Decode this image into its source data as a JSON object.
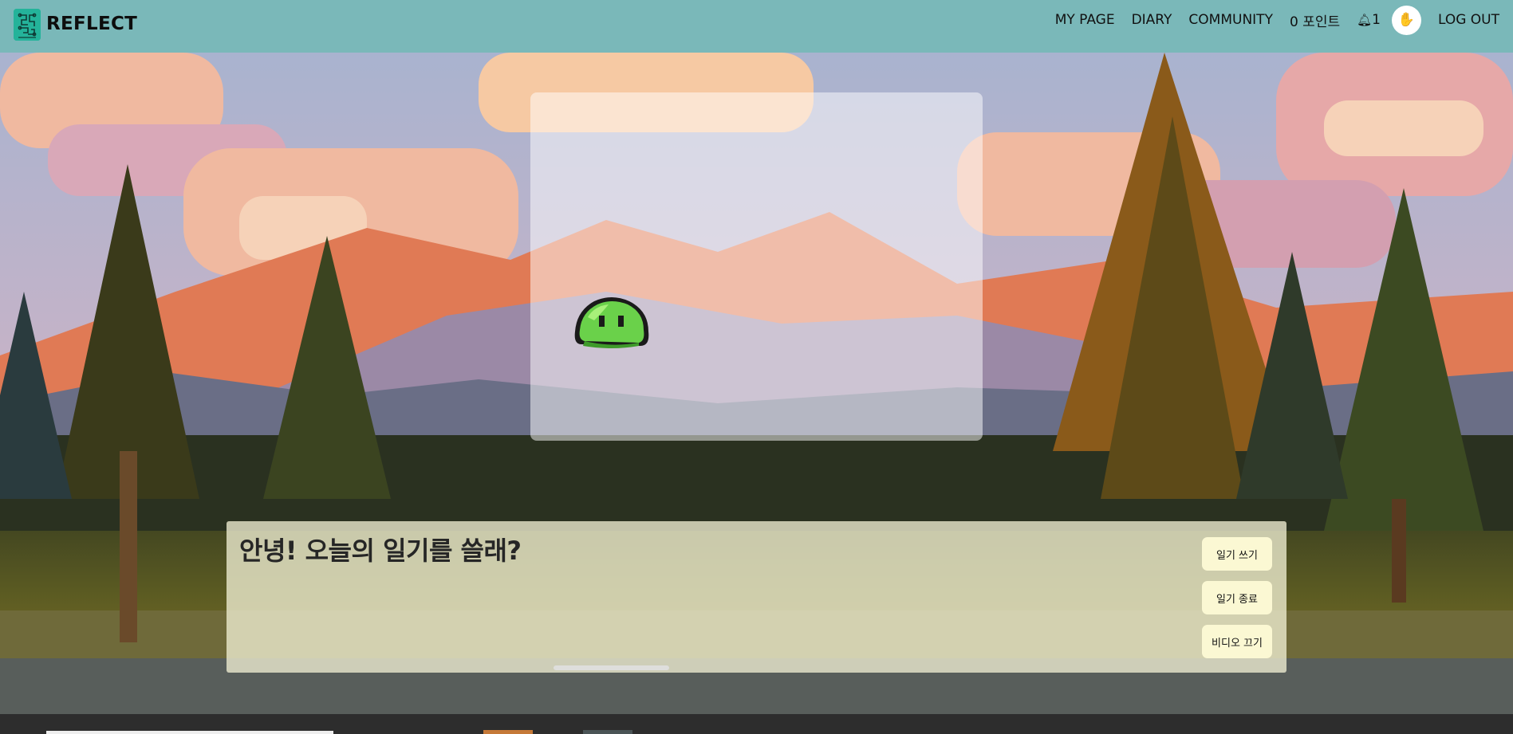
{
  "app": {
    "brand": "REFLECT",
    "logo_icon": "brain-circuit-icon",
    "logo_color": "#24b39a",
    "header_color": "#7ab8b9"
  },
  "nav": {
    "my_page": "MY PAGE",
    "diary": "DIARY",
    "community": "COMMUNITY",
    "points": "0 포인트",
    "notifications": "1",
    "notification_icon": "bell-icon",
    "avatar_icon": "hand-icon",
    "logout": "LOG OUT"
  },
  "video": {
    "character_icon": "green-slime-icon"
  },
  "dialog": {
    "message": "안녕! 오늘의 일기를 쓸래?",
    "buttons": {
      "write": "일기 쓰기",
      "end": "일기 종료",
      "video_off": "비디오 끄기"
    },
    "button_color": "#fbf8d3"
  }
}
